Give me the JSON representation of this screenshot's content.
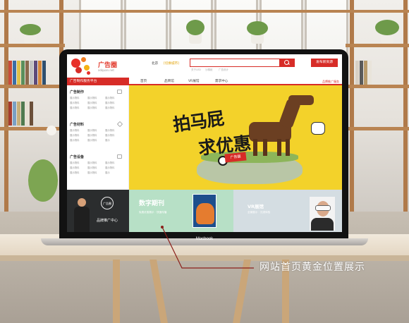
{
  "site": {
    "logo_name": "广告圈",
    "logo_domain": "adquan.net",
    "city": "北京",
    "city_switch": "[切换城市]",
    "publish_button": "发布新资源",
    "hot_searches": [
      "关于LED",
      "沙棉纸",
      "广告设计"
    ]
  },
  "nav": {
    "main": "广告制作服务平台",
    "items": [
      "首页",
      "品牌馆",
      "VR展馆",
      "需求中心"
    ],
    "right": "品牌推广服务"
  },
  "sidebar": {
    "sections": [
      {
        "title": "广告制作",
        "icon": "ad-production-icon",
        "cells": [
          "展示物料",
          "展示物料",
          "展示物料",
          "展示物料",
          "展示物料",
          "展示物料",
          "展示物料",
          "展示物料",
          "展示物料"
        ]
      },
      {
        "title": "广告材料",
        "icon": "diamond-icon",
        "cells": [
          "展示物料",
          "展示物料",
          "展示物料",
          "展示物料",
          "展示物料",
          "展示物料",
          "展示物料",
          "展示物料",
          "展示"
        ]
      },
      {
        "title": "广告设备",
        "icon": "equipment-icon",
        "cells": [
          "展示物料",
          "展示物料",
          "展示物料",
          "展示物料",
          "展示物料",
          "展示物料",
          "展示物料",
          "展示物料",
          "展示"
        ]
      }
    ]
  },
  "banner": {
    "slogan_line1": "拍马屁",
    "slogan_line2": "求优惠",
    "badge": "广告圈"
  },
  "tiles": {
    "brand": {
      "badge": "广告圈",
      "text": "品牌推广中心"
    },
    "magazine": {
      "title": "数字期刊",
      "sub": "免费优惠展示 · 快速传播"
    },
    "vr": {
      "title": "VR展馆",
      "sub": "全景展示 · 沉浸体验"
    }
  },
  "laptop": {
    "brand": "Macbook"
  },
  "caption": "网站首页黄金位置展示",
  "colors": {
    "brand_red": "#d72c27",
    "banner_yellow": "#f3d22a",
    "tile_green": "#b7e0c6",
    "tile_dark": "#2b2d2e"
  }
}
